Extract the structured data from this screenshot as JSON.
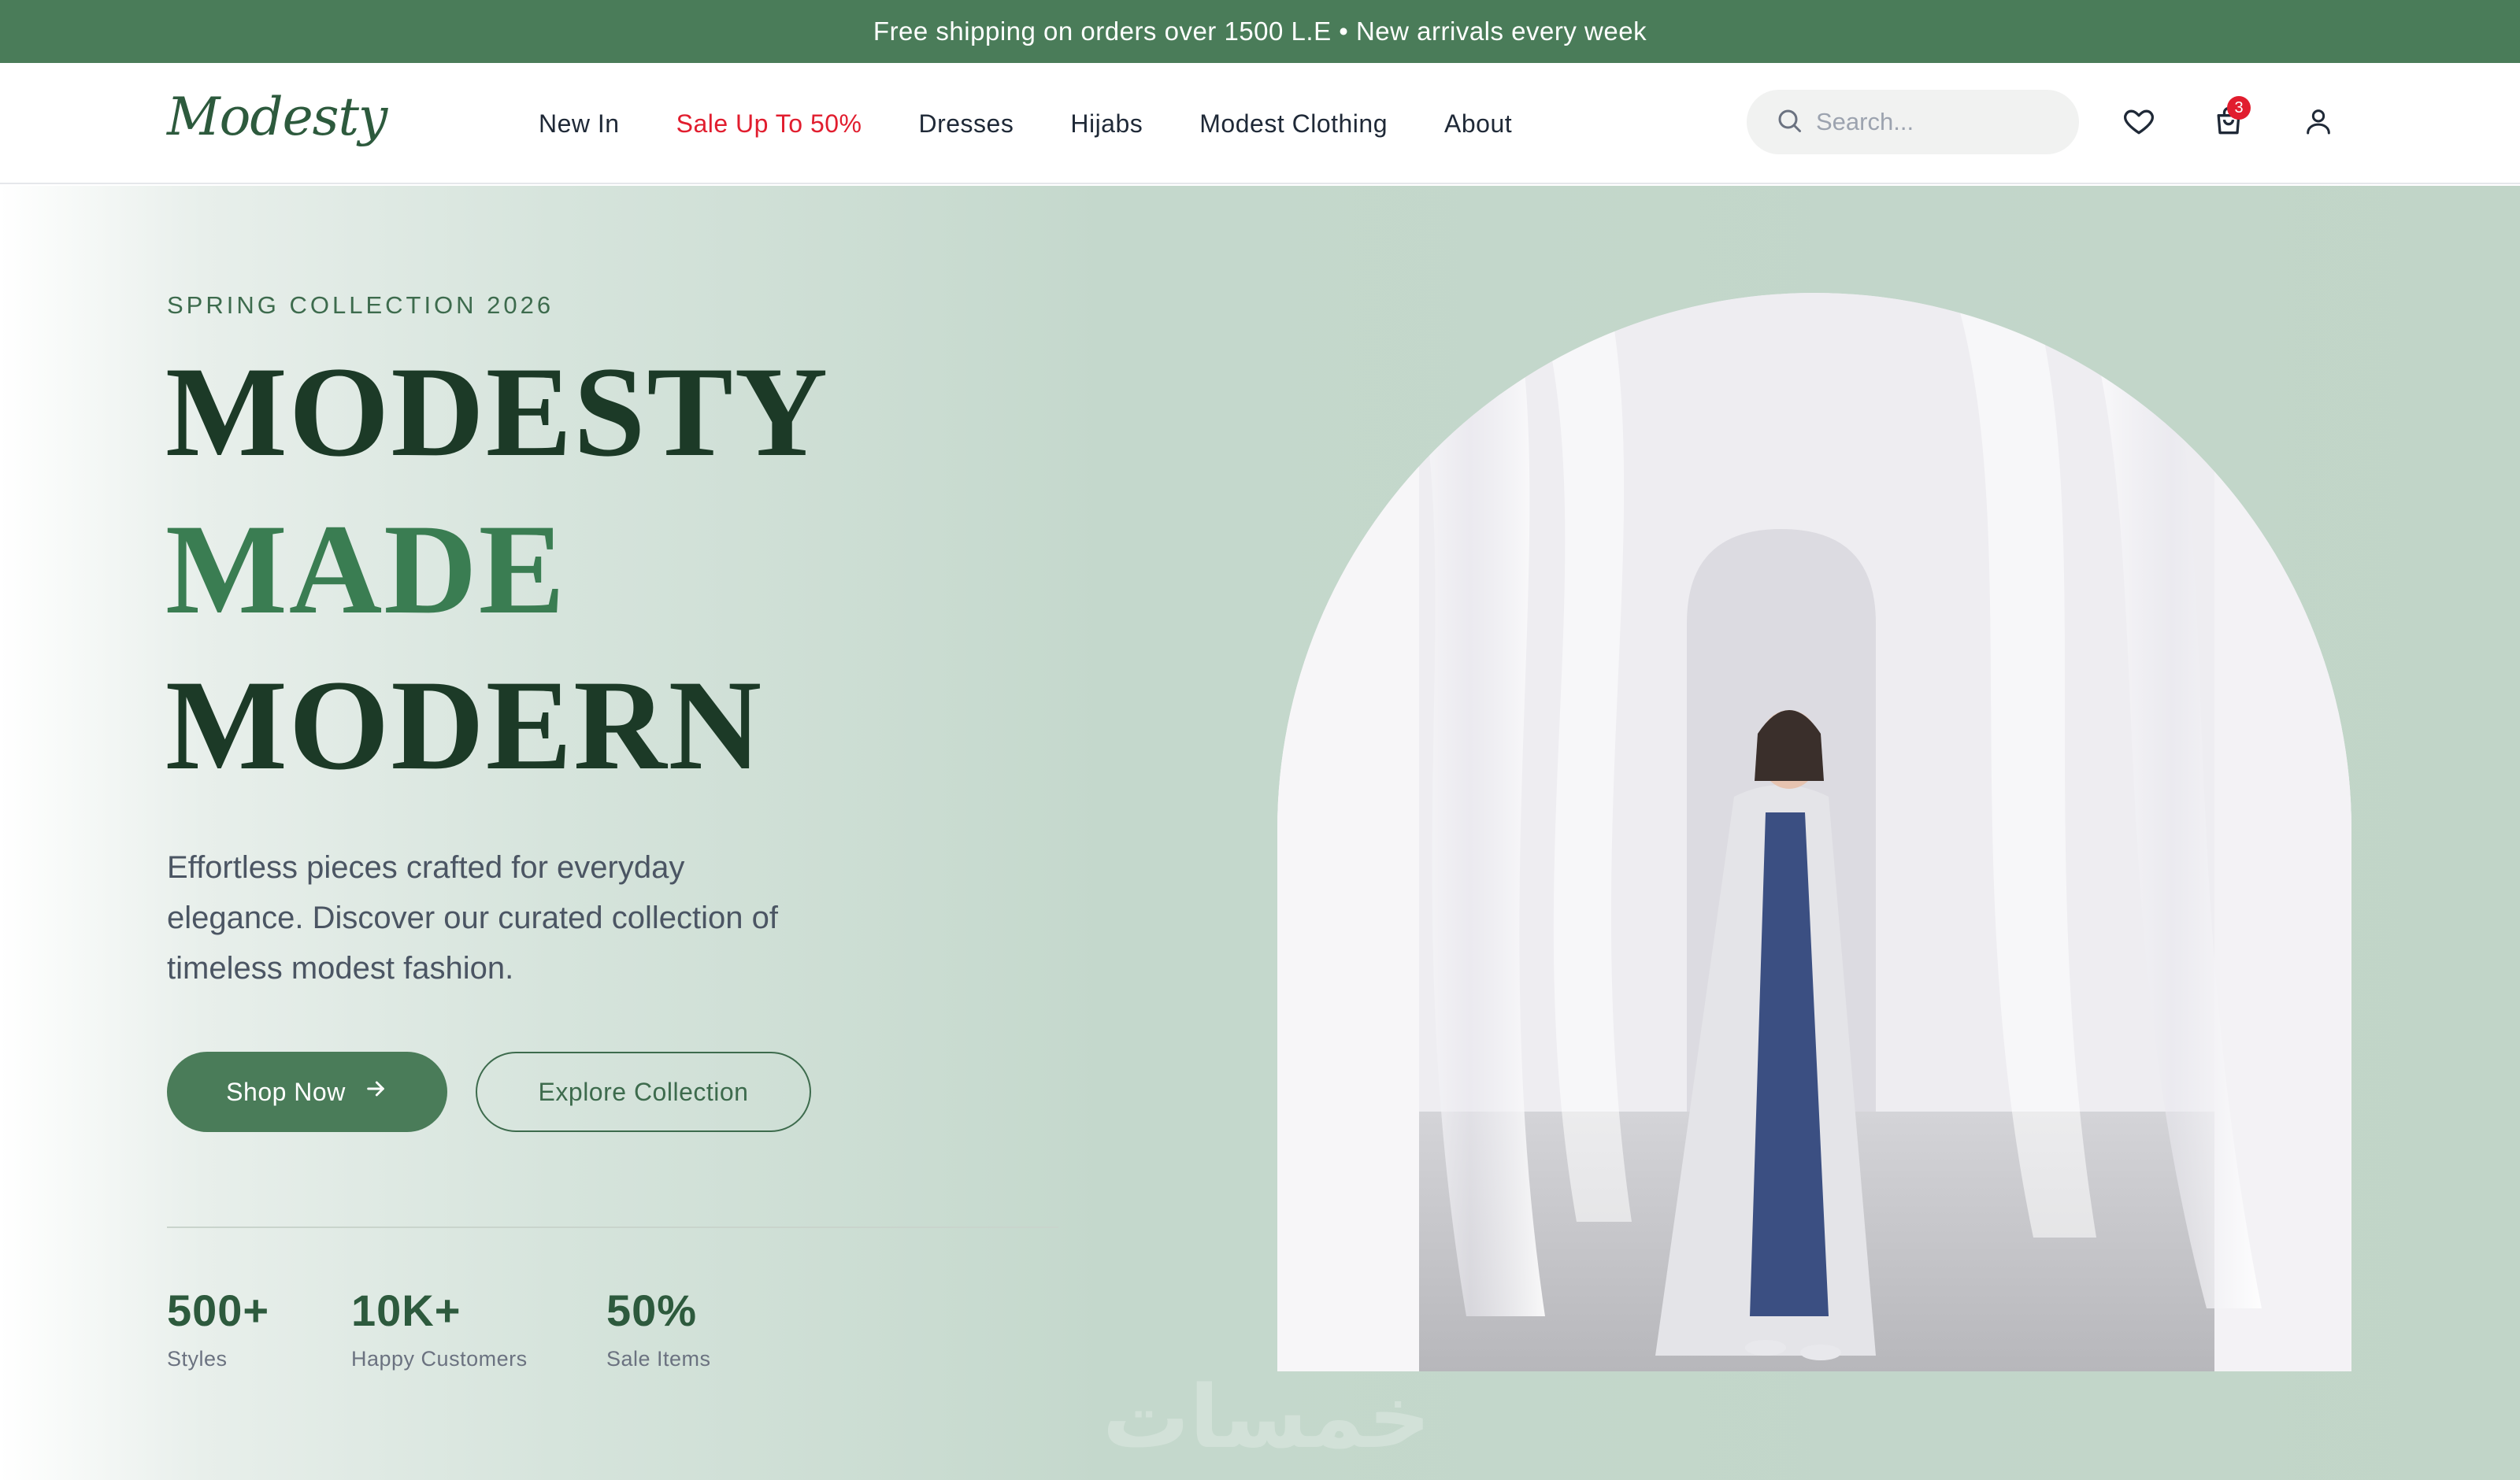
{
  "announcement": {
    "text": "Free shipping on orders over 1500 L.E • New arrivals every week"
  },
  "header": {
    "logo_text": "Modesty",
    "nav": [
      {
        "label": "New In"
      },
      {
        "label": "Sale Up To 50%",
        "highlight": true
      },
      {
        "label": "Dresses"
      },
      {
        "label": "Hijabs"
      },
      {
        "label": "Modest Clothing"
      },
      {
        "label": "About"
      }
    ],
    "search": {
      "placeholder": "Search..."
    },
    "icons": {
      "wishlist": "heart-icon",
      "cart": "shopping-bag-icon",
      "account": "user-icon"
    },
    "cart_count": "3"
  },
  "hero": {
    "eyebrow": "SPRING COLLECTION 2026",
    "title_line1": "MODESTY",
    "title_line2": "MADE",
    "title_line3": "MODERN",
    "description": "Effortless pieces crafted for everyday elegance. Discover our curated collection of timeless modest fashion.",
    "primary_cta": "Shop Now",
    "secondary_cta": "Explore Collection",
    "stats": [
      {
        "value": "500+",
        "label": "Styles"
      },
      {
        "value": "10K+",
        "label": "Happy Customers"
      },
      {
        "value": "50%",
        "label": "Sale Items"
      }
    ]
  },
  "watermark": "خمسات",
  "colors": {
    "brand_green": "#4a7c59",
    "dark_green": "#1c3a27",
    "accent_green": "#3a7d52",
    "sale_red": "#e11d2e",
    "hero_bg": "#c1d5c8"
  }
}
